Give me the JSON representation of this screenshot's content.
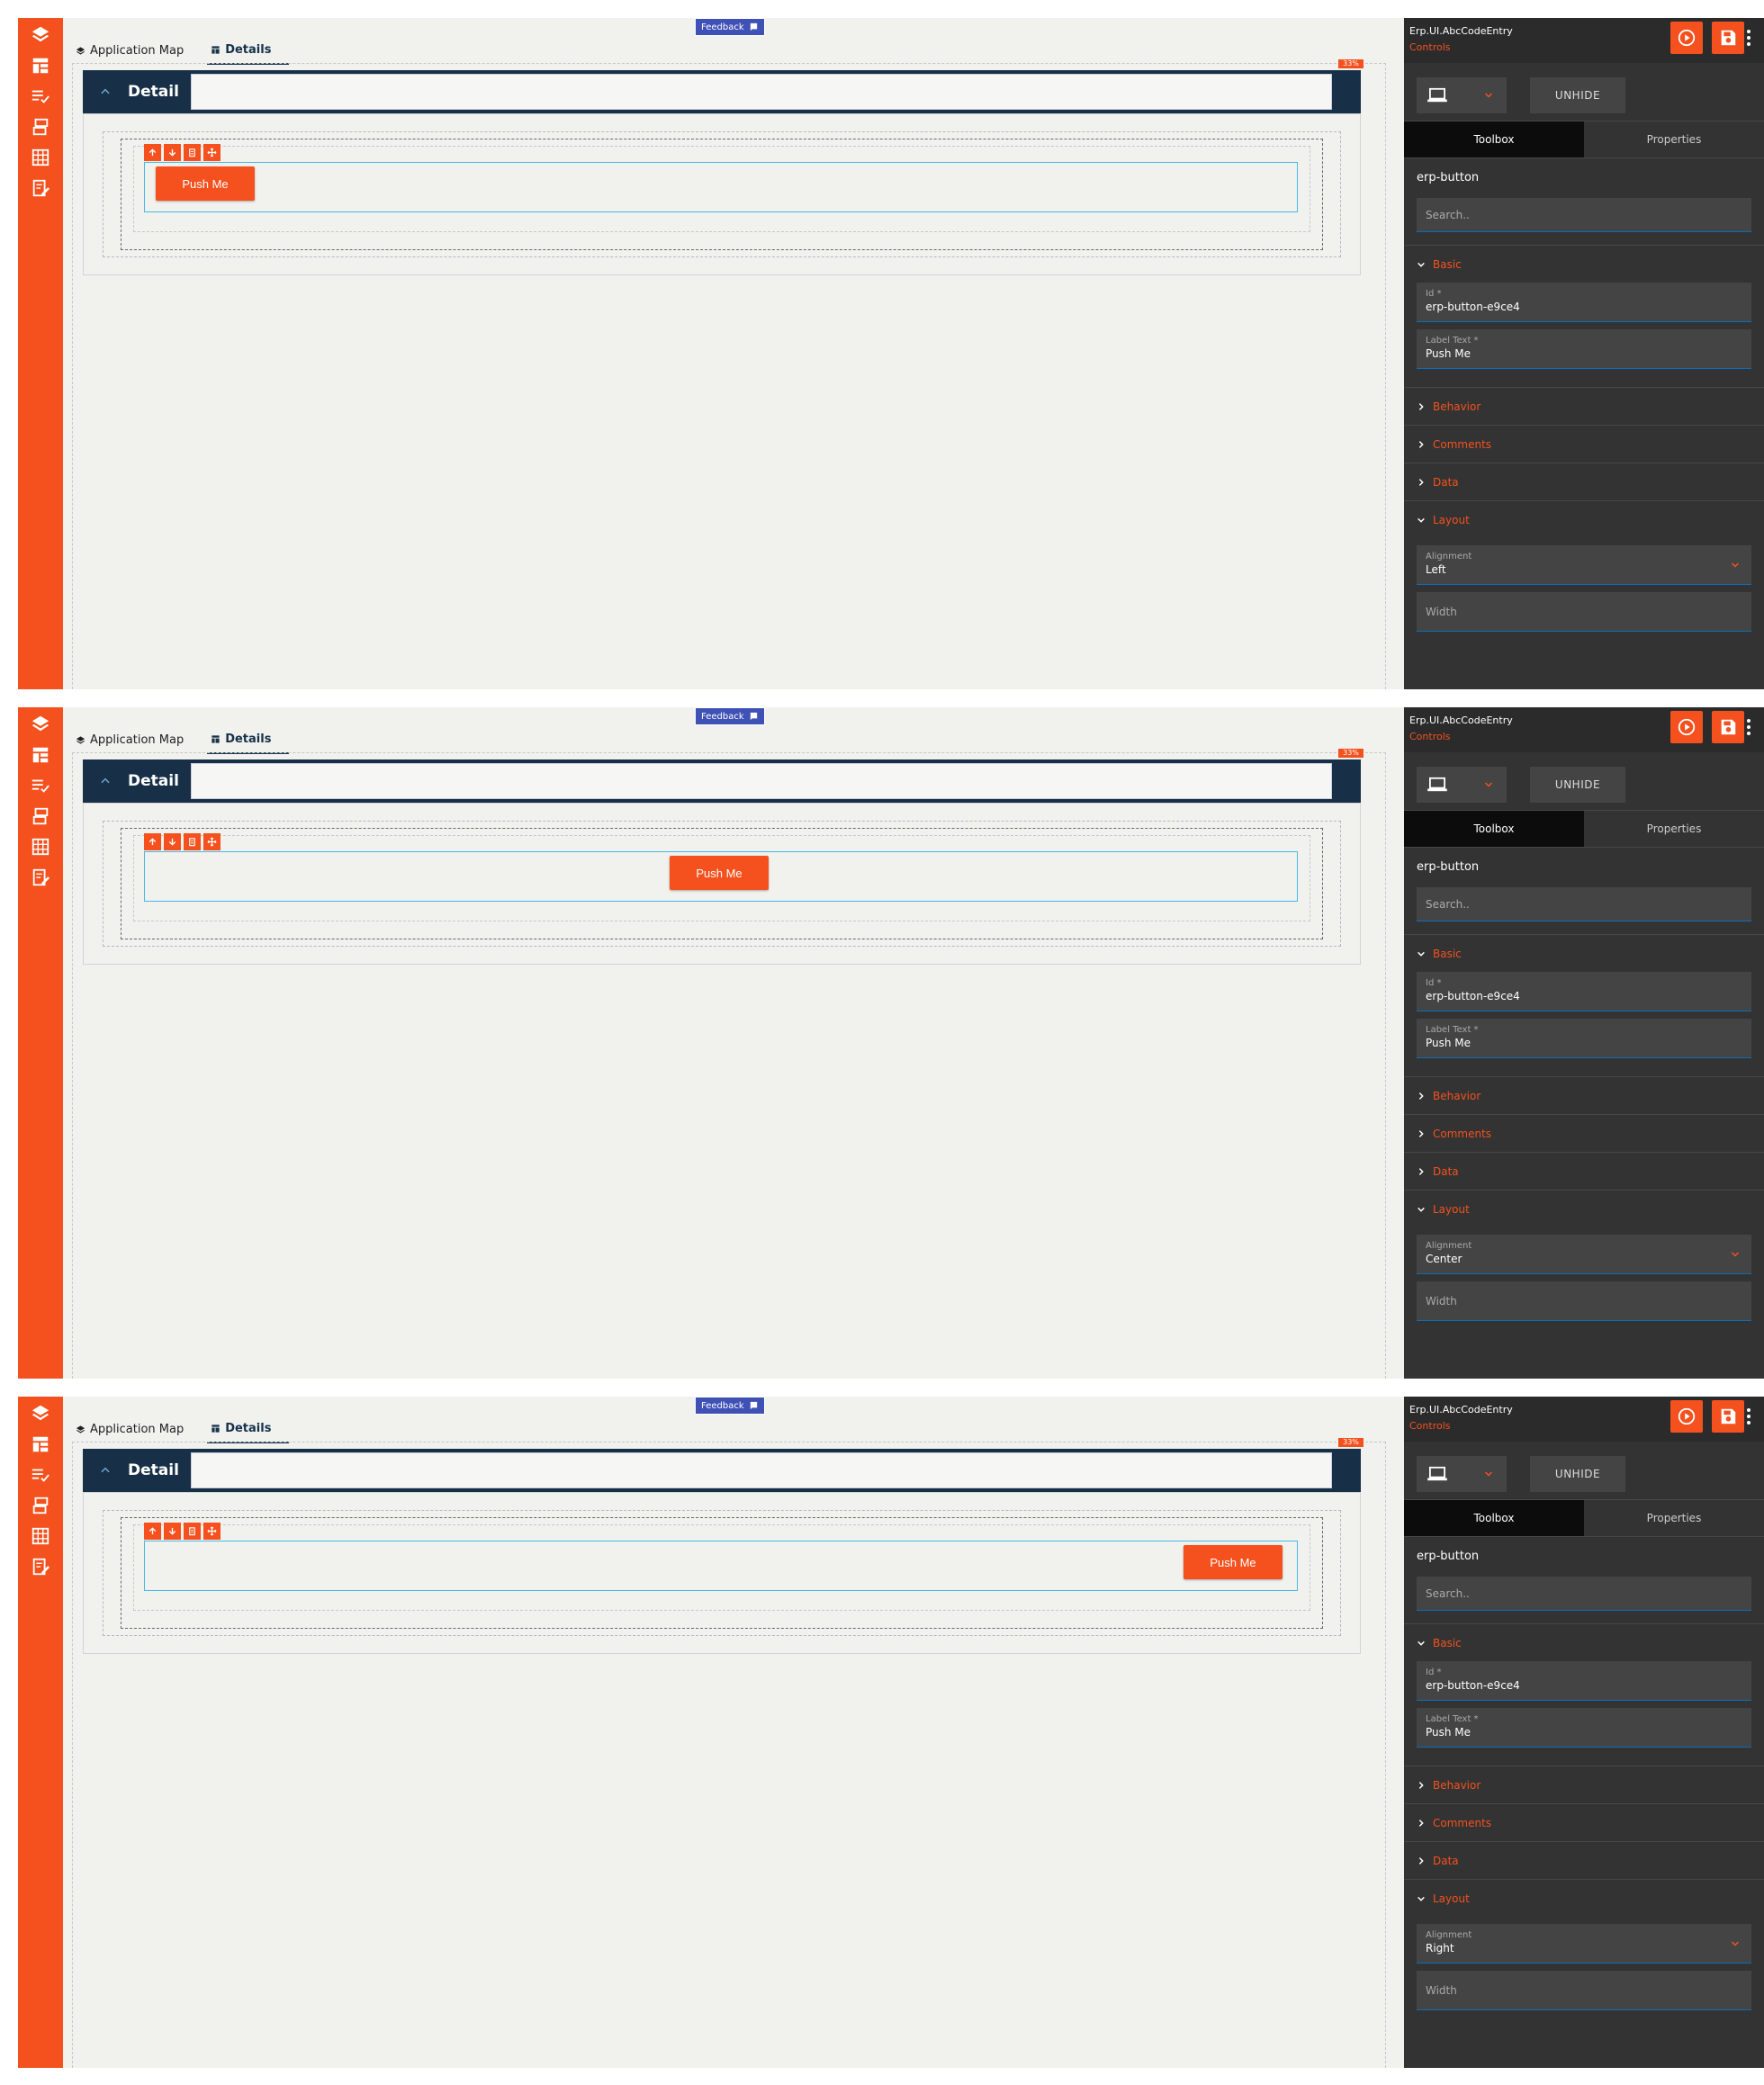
{
  "tabs": {
    "app_map": "Application Map",
    "details": "Details"
  },
  "feedback": "Feedback",
  "detail_title": "Detail",
  "zoom_badge": "33%",
  "button_label": "Push Me",
  "side": {
    "app_name": "Erp.UI.AbcCodeEntry",
    "app_sub": "Controls",
    "unhide": "UNHIDE",
    "tab_toolbox": "Toolbox",
    "tab_properties": "Properties",
    "component": "erp-button",
    "search_placeholder": "Search..",
    "section_basic": "Basic",
    "id_label": "Id *",
    "id_value": "erp-button-e9ce4",
    "label_text_label": "Label Text *",
    "label_text_value": "Push Me",
    "section_behavior": "Behavior",
    "section_comments": "Comments",
    "section_data": "Data",
    "section_layout": "Layout",
    "alignment_label": "Alignment",
    "width_label": "Width"
  },
  "panels": [
    {
      "alignment": "Left"
    },
    {
      "alignment": "Center"
    },
    {
      "alignment": "Right"
    }
  ],
  "colors": {
    "accent": "#f4511e",
    "detail_header": "#173047",
    "side_bg": "#333333",
    "feedback": "#3f51b5"
  },
  "icons": [
    "layers-icon",
    "layout-icon",
    "checklist-icon",
    "pages-icon",
    "grid-icon",
    "edit-icon",
    "play-icon",
    "save-icon",
    "more-vert-icon",
    "laptop-icon",
    "chevron-down-icon",
    "chevron-right-icon",
    "chevron-up-icon"
  ]
}
